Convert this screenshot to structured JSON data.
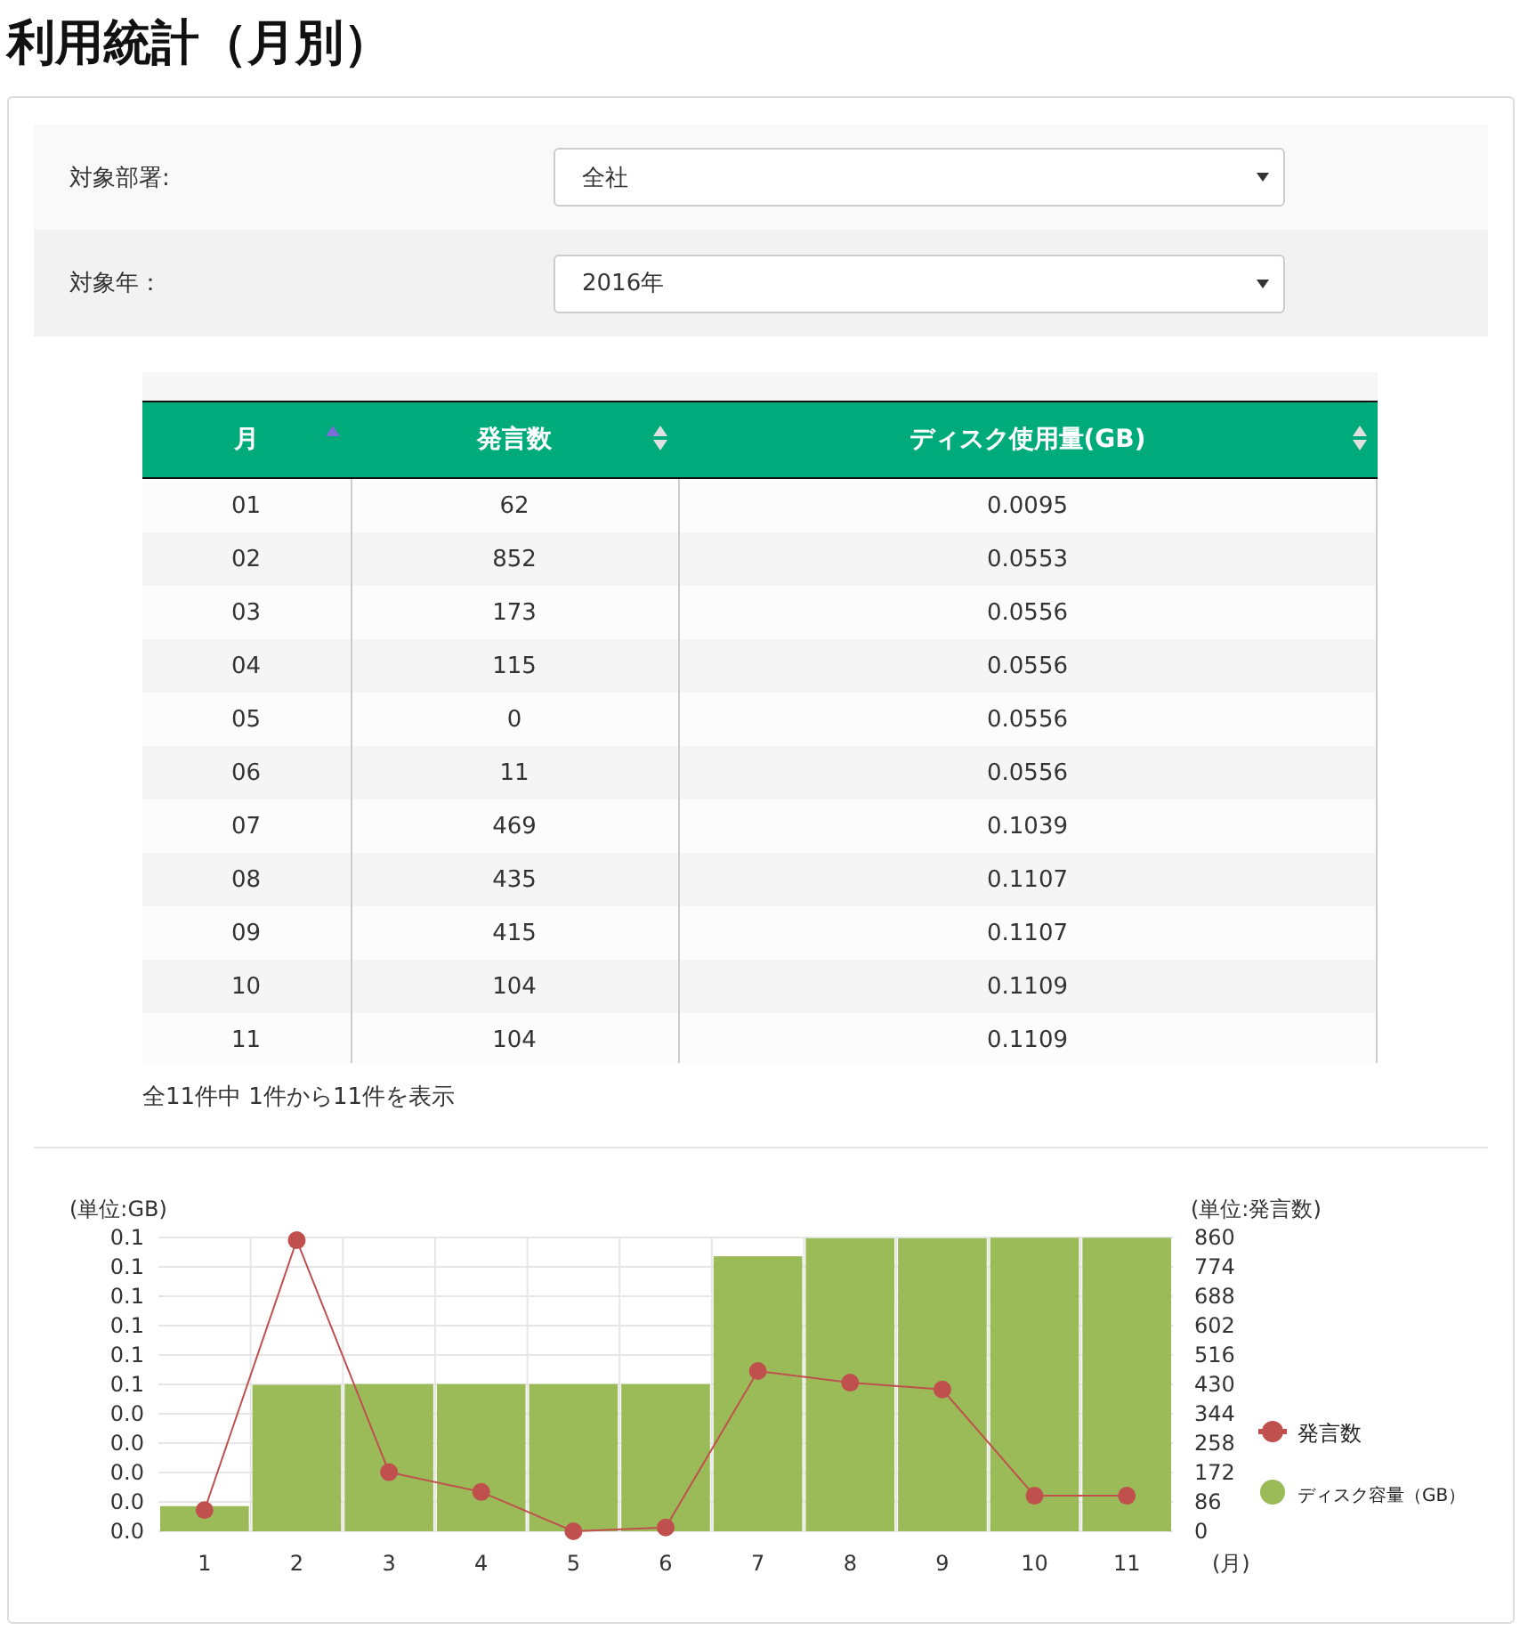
{
  "title": "利用統計（月別）",
  "filters": [
    {
      "label": "対象部署:",
      "value": "全社"
    },
    {
      "label": "対象年：",
      "value": "2016年"
    }
  ],
  "table": {
    "columns": [
      {
        "label": "月",
        "sorted": true
      },
      {
        "label": "発言数",
        "sorted": false
      },
      {
        "label": "ディスク使用量(GB)",
        "sorted": false
      }
    ],
    "rows": [
      [
        "01",
        "62",
        "0.0095"
      ],
      [
        "02",
        "852",
        "0.0553"
      ],
      [
        "03",
        "173",
        "0.0556"
      ],
      [
        "04",
        "115",
        "0.0556"
      ],
      [
        "05",
        "0",
        "0.0556"
      ],
      [
        "06",
        "11",
        "0.0556"
      ],
      [
        "07",
        "469",
        "0.1039"
      ],
      [
        "08",
        "435",
        "0.1107"
      ],
      [
        "09",
        "415",
        "0.1107"
      ],
      [
        "10",
        "104",
        "0.1109"
      ],
      [
        "11",
        "104",
        "0.1109"
      ]
    ]
  },
  "table_info": "全11件中 1件から11件を表示",
  "chart_data": {
    "type": "bar",
    "xlabel": "(月)",
    "ylabel": "(単位:GB)",
    "y2label": "(単位:発言数)",
    "categories": [
      "1",
      "2",
      "3",
      "4",
      "5",
      "6",
      "7",
      "8",
      "9",
      "10",
      "11"
    ],
    "grid": true,
    "legend": "right",
    "series": [
      {
        "name": "発言数",
        "type": "line",
        "axis": "y2",
        "marker": "circle",
        "color": "#c0504d",
        "values": [
          62,
          852,
          173,
          115,
          0,
          11,
          469,
          435,
          415,
          104,
          104
        ]
      },
      {
        "name": "ディスク容量（GB）",
        "type": "bar",
        "color": "#9bbb59",
        "values": [
          0.0095,
          0.0553,
          0.0556,
          0.0556,
          0.0556,
          0.0556,
          0.1039,
          0.1107,
          0.1107,
          0.1109,
          0.1109
        ]
      }
    ],
    "ylim": [
      0,
      0.111
    ],
    "y2lim": [
      0,
      860
    ],
    "yticks": [
      {
        "value": 0,
        "label": "0.0"
      },
      {
        "value": 0.0111,
        "label": "0.0"
      },
      {
        "value": 0.0222,
        "label": "0.0"
      },
      {
        "value": 0.0333,
        "label": "0.0"
      },
      {
        "value": 0.0444,
        "label": "0.0"
      },
      {
        "value": 0.0555,
        "label": "0.1"
      },
      {
        "value": 0.0666,
        "label": "0.1"
      },
      {
        "value": 0.0777,
        "label": "0.1"
      },
      {
        "value": 0.0888,
        "label": "0.1"
      },
      {
        "value": 0.0999,
        "label": "0.1"
      },
      {
        "value": 0.111,
        "label": "0.1"
      }
    ],
    "y2ticks": [
      0,
      86,
      172,
      258,
      344,
      430,
      516,
      602,
      688,
      774,
      860
    ]
  }
}
